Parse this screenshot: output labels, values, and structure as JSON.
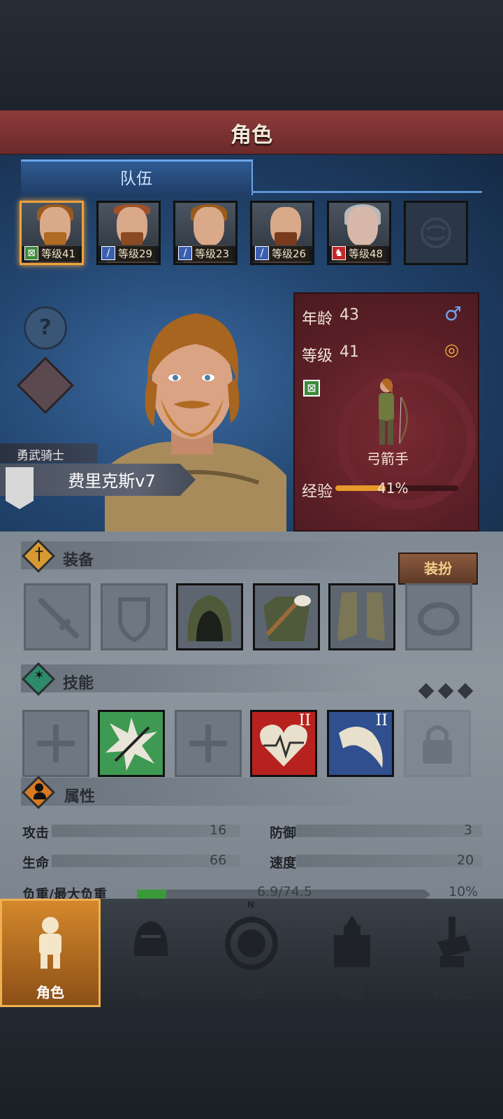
{
  "title": "角色",
  "tabs": {
    "team": "队伍"
  },
  "members": [
    {
      "level_label": "等级41",
      "class": "archer"
    },
    {
      "level_label": "等级29",
      "class": "sword"
    },
    {
      "level_label": "等级23",
      "class": "sword"
    },
    {
      "level_label": "等级26",
      "class": "sword"
    },
    {
      "level_label": "等级48",
      "class": "beast"
    }
  ],
  "hero": {
    "subtitle": "勇武骑士",
    "name": "费里克斯v7"
  },
  "card": {
    "age_label": "年龄",
    "age": "43",
    "level_label": "等级",
    "level": "41",
    "class_name": "弓箭手",
    "exp_label": "经验",
    "exp_pct": "41%",
    "exp_fraction": 0.41
  },
  "equipment": {
    "title": "装备",
    "dress_button": "装扮"
  },
  "skills": {
    "title": "技能",
    "rank_a": "II",
    "rank_b": "II"
  },
  "attributes": {
    "title": "属性",
    "attack_label": "攻击",
    "attack": "16",
    "defense_label": "防御",
    "defense": "3",
    "hp_label": "生命",
    "hp": "66",
    "speed_label": "速度",
    "speed": "20",
    "load_label": "负重/最大负重",
    "load": "6.9/74.5",
    "load_pct": "10%",
    "load_fraction": 0.1
  },
  "nav": {
    "character": "角色",
    "formation": "编队",
    "map": "地图",
    "castle": "城堡",
    "mercenary": "佣兵团",
    "compass_n": "N"
  },
  "colors": {
    "accent_orange": "#f0a23a",
    "title_red": "#8e3b3b",
    "panel_blue": "#22456f",
    "exp_orange": "#e89a2a",
    "load_green": "#3a9a3a"
  }
}
